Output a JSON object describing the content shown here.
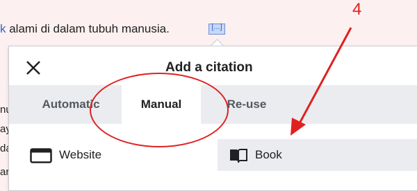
{
  "article": {
    "link_fragment": "k",
    "text": " alami di dalam tubuh manusia.",
    "cite_marker": "[...]",
    "side_fragments": [
      "nu",
      "ay",
      "da",
      "ar"
    ]
  },
  "dialog": {
    "title": "Add a citation",
    "close_icon": "close-icon",
    "tabs": [
      {
        "label": "Automatic",
        "active": false
      },
      {
        "label": "Manual",
        "active": true
      },
      {
        "label": "Re-use",
        "active": false
      }
    ],
    "options": [
      {
        "label": "Website",
        "icon": "browser-window-icon"
      },
      {
        "label": "Book",
        "icon": "book-icon"
      }
    ]
  },
  "annotation": {
    "step_number": "4",
    "color": "#e02020"
  },
  "colors": {
    "link": "#3366cc",
    "tabbar_bg": "#eaecf0",
    "page_bg": "#fdf0f0"
  }
}
